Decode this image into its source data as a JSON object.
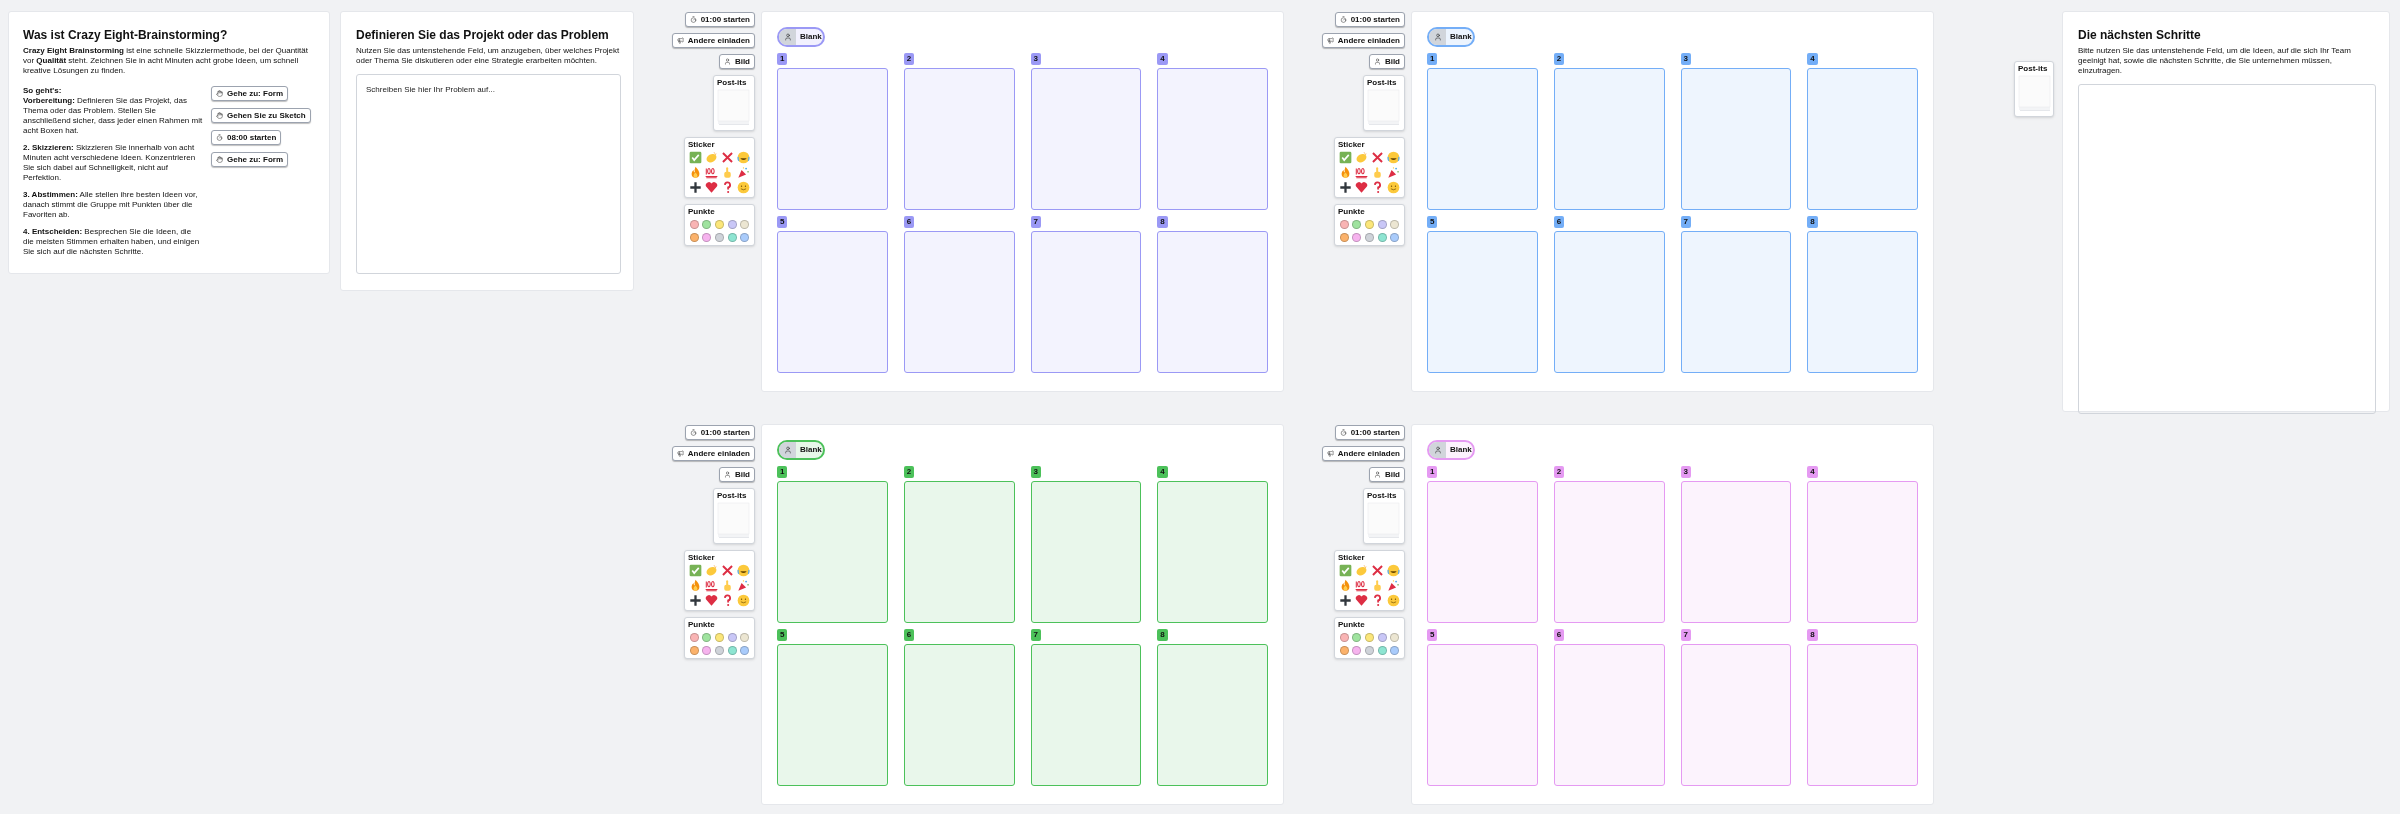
{
  "intro_card": {
    "title": "Was ist Crazy Eight-Brainstorming?",
    "intro": "**Crazy Eight Brainstorming** ist eine schnelle Skizziermethode, bei der Quantität vor **Qualität** steht. Zeichnen Sie in acht Minuten acht grobe Ideen, um schnell kreative Lösungen zu finden.",
    "steps": [
      "**So geht's:**\n**Vorbereitung:** Definieren Sie das Projekt, das Thema oder das Problem. Stellen Sie anschließend sicher, dass jeder einen Rahmen mit acht Boxen hat.",
      "**2. Skizzieren:** Skizzieren Sie innerhalb von acht Minuten acht verschiedene Ideen. Konzentrieren Sie sich dabei auf Schnelligkeit, nicht auf Perfektion.",
      "**3. Abstimmen:** Alle stellen ihre besten Ideen vor, danach stimmt die Gruppe mit Punkten über die Favoriten ab.",
      "**4. Entscheiden:** Besprechen Sie die Ideen, die die meisten Stimmen erhalten haben, und einigen Sie sich auf die nächsten Schritte."
    ],
    "buttons": [
      {
        "kind": "hand",
        "label": "Gehe zu: Form"
      },
      {
        "kind": "hand",
        "label": "Gehen Sie zu Sketch"
      },
      {
        "kind": "timer",
        "label": "08:00 starten"
      },
      {
        "kind": "hand",
        "label": "Gehe zu: Form"
      }
    ]
  },
  "problem_card": {
    "title": "Definieren Sie das Projekt oder das Problem",
    "description": "Nutzen Sie das untenstehende Feld, um anzugeben, über welches Projekt oder Thema Sie diskutieren oder eine Strategie erarbeiten möchten.",
    "placeholder": "Schreiben Sie hier Ihr Problem auf..."
  },
  "frames": [
    {
      "color": "#9b99f5",
      "timer_button": "01:00 starten",
      "invite_button": "Andere einladen",
      "person_button": "Bild",
      "postits_label": "Post-its",
      "stickers_label": "Sticker",
      "dots_label": "Punkte",
      "owner_label": "Blank",
      "cells": [
        "1",
        "2",
        "3",
        "4",
        "5",
        "6",
        "7",
        "8"
      ]
    },
    {
      "color": "#74aef7",
      "timer_button": "01:00 starten",
      "invite_button": "Andere einladen",
      "person_button": "Bild",
      "postits_label": "Post-its",
      "stickers_label": "Sticker",
      "dots_label": "Punkte",
      "owner_label": "Blank",
      "cells": [
        "1",
        "2",
        "3",
        "4",
        "5",
        "6",
        "7",
        "8"
      ]
    },
    {
      "color": "#4cc15a",
      "timer_button": "01:00 starten",
      "invite_button": "Andere einladen",
      "person_button": "Bild",
      "postits_label": "Post-its",
      "stickers_label": "Sticker",
      "dots_label": "Punkte",
      "owner_label": "Blank",
      "cells": [
        "1",
        "2",
        "3",
        "4",
        "5",
        "6",
        "7",
        "8"
      ]
    },
    {
      "color": "#e59af2",
      "timer_button": "01:00 starten",
      "invite_button": "Andere einladen",
      "person_button": "Bild",
      "postits_label": "Post-its",
      "stickers_label": "Sticker",
      "dots_label": "Punkte",
      "owner_label": "Blank",
      "cells": [
        "1",
        "2",
        "3",
        "4",
        "5",
        "6",
        "7",
        "8"
      ]
    }
  ],
  "next_steps_card": {
    "title": "Die nächsten Schritte",
    "description": "Bitte nutzen Sie das untenstehende Feld, um die Ideen, auf die sich Ihr Team geeinigt hat, sowie die nächsten Schritte, die Sie unternehmen müssen, einzutragen.",
    "postits_label": "Post-its"
  }
}
